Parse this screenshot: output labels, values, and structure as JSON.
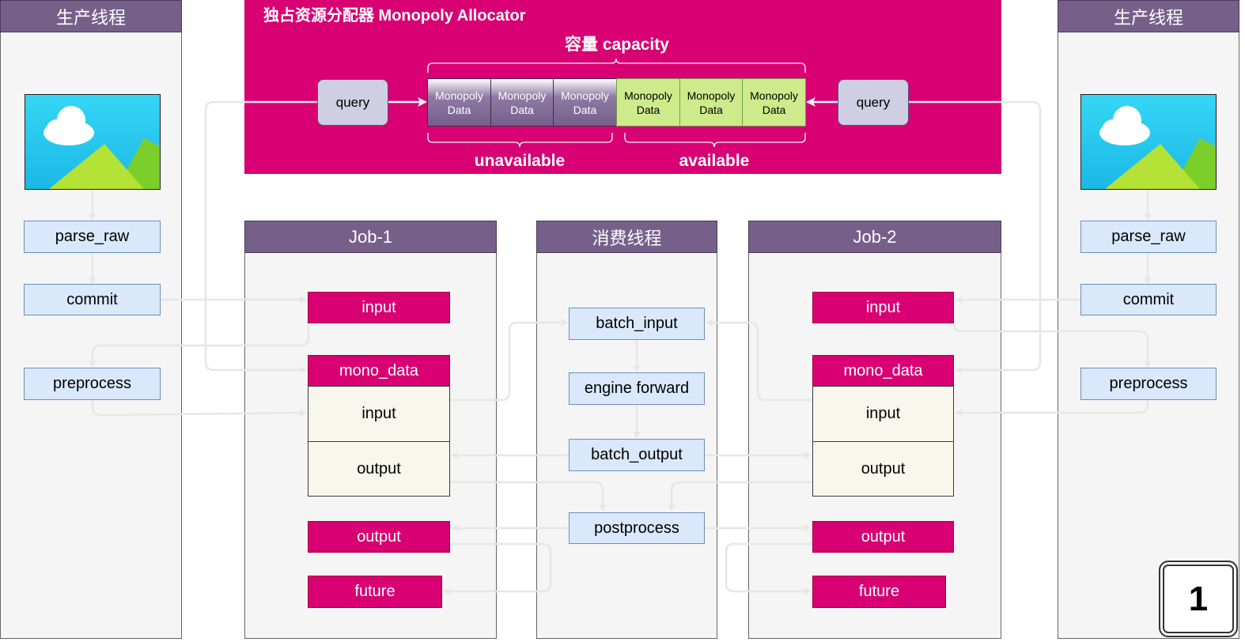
{
  "lanes": {
    "producer_left": "生产线程",
    "producer_right": "生产线程",
    "job1": "Job-1",
    "consumer": "消费线程",
    "job2": "Job-2"
  },
  "allocator": {
    "title": "独占资源分配器 Monopoly Allocator",
    "capacity": "容量 capacity",
    "unavailable": "unavailable",
    "available": "available",
    "query": "query",
    "cell_line1": "Monopoly",
    "cell_line2": "Data"
  },
  "producer": {
    "parse_raw": "parse_raw",
    "commit": "commit",
    "preprocess": "preprocess"
  },
  "job": {
    "input": "input",
    "mono_data": "mono_data",
    "mono_input": "input",
    "mono_output": "output",
    "output": "output",
    "future": "future"
  },
  "consumer": {
    "batch_input": "batch_input",
    "engine_forward": "engine forward",
    "batch_output": "batch_output",
    "postprocess": "postprocess"
  },
  "badge": "1",
  "colors": {
    "lane_header": "#76608a",
    "allocator_bg": "#d80073",
    "node_fill": "#dae8fc",
    "available_fill": "#cdeb8b",
    "arrow": "#e6e6e6"
  }
}
